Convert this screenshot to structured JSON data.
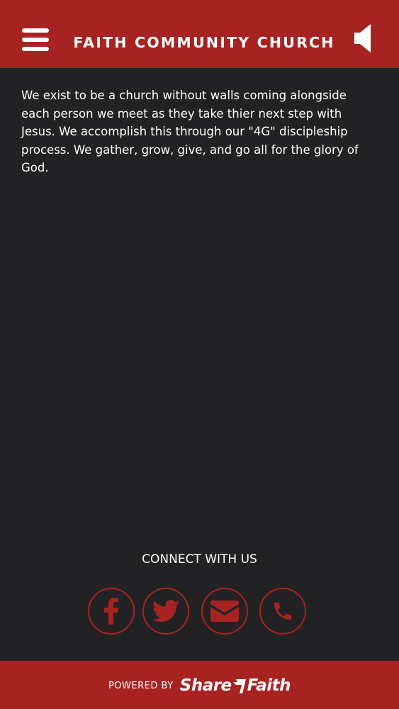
{
  "header": {
    "title": "FAITH COMMUNITY CHURCH",
    "menu_icon": "hamburger-menu-icon",
    "sound_icon": "speaker-icon"
  },
  "content": {
    "text": "We exist to be a church without walls coming alongside each person we meet as they take thier next step with Jesus. We accomplish this through our \"4G\" discipleship process. We gather, grow, give, and go all for the glory of God."
  },
  "connect": {
    "title": "CONNECT WITH US",
    "buttons": [
      {
        "icon": "facebook-icon"
      },
      {
        "icon": "twitter-icon"
      },
      {
        "icon": "email-icon"
      },
      {
        "icon": "phone-icon"
      }
    ]
  },
  "footer": {
    "powered_by": "POWERED BY",
    "brand_part1": "Share",
    "brand_part2": "Faith"
  },
  "colors": {
    "accent": "#a72322",
    "background": "#222224",
    "text": "#ffffff"
  }
}
